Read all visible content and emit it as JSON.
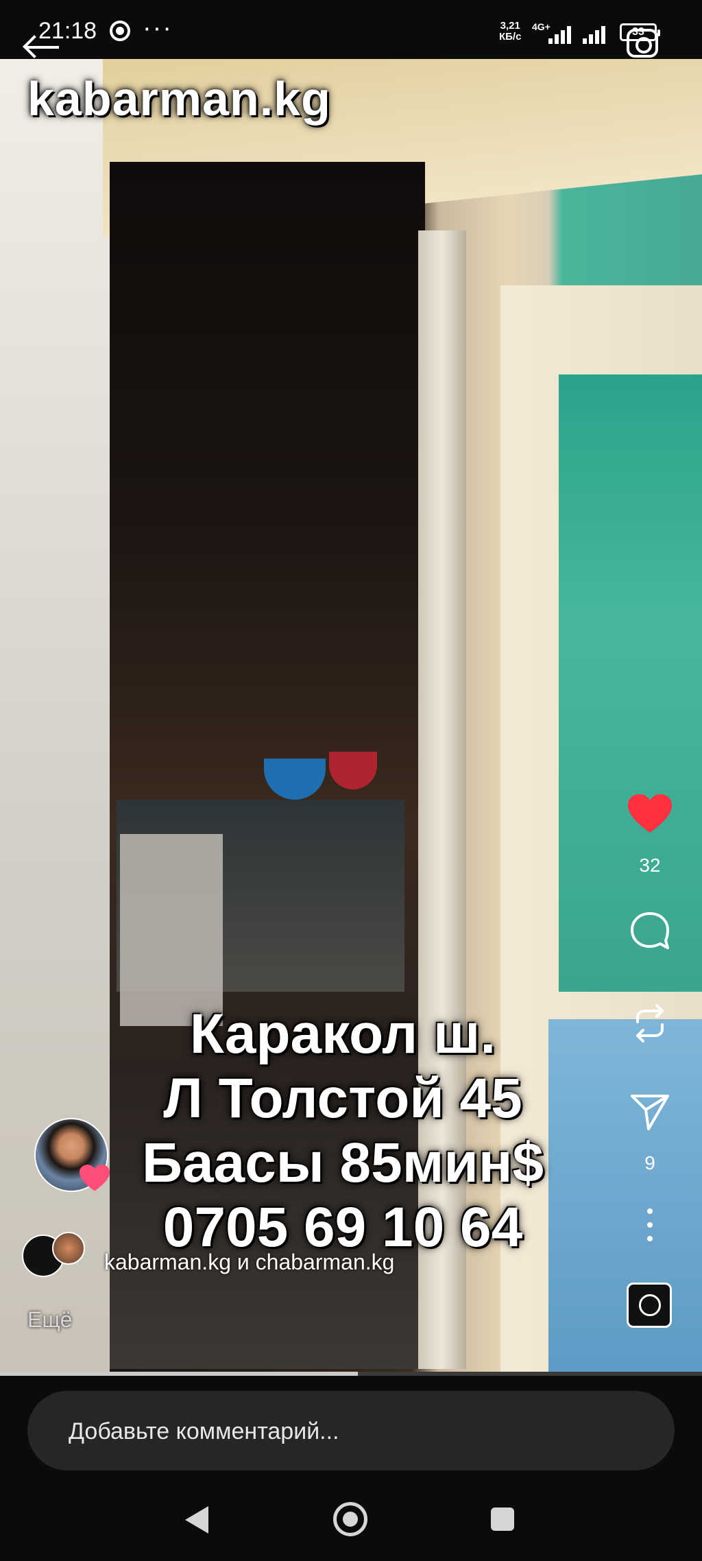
{
  "status_bar": {
    "time": "21:18",
    "dots": "···",
    "net_speed_value": "3,21",
    "net_speed_unit": "КБ/с",
    "net_gen": "4G+",
    "battery": "33"
  },
  "post": {
    "brand": "kabarman.kg",
    "overlay_lines": [
      "Каракол ш.",
      "Л Толстой 45",
      "Баасы 85мин$",
      "0705 69 10 64"
    ],
    "authors": "kabarman.kg и chabarman.kg",
    "more_label": "Ещё",
    "like_count": "32",
    "share_count": "9",
    "progress": 0.51
  },
  "icons": {
    "back": "back-arrow-icon",
    "camera": "camera-icon",
    "like": "heart-icon",
    "comment": "comment-icon",
    "repost": "repost-icon",
    "share": "send-icon",
    "more": "more-vertical-icon"
  },
  "comment": {
    "placeholder": "Добавьте комментарий..."
  },
  "colors": {
    "like": "#ff3040",
    "background": "#0b0b0d"
  }
}
